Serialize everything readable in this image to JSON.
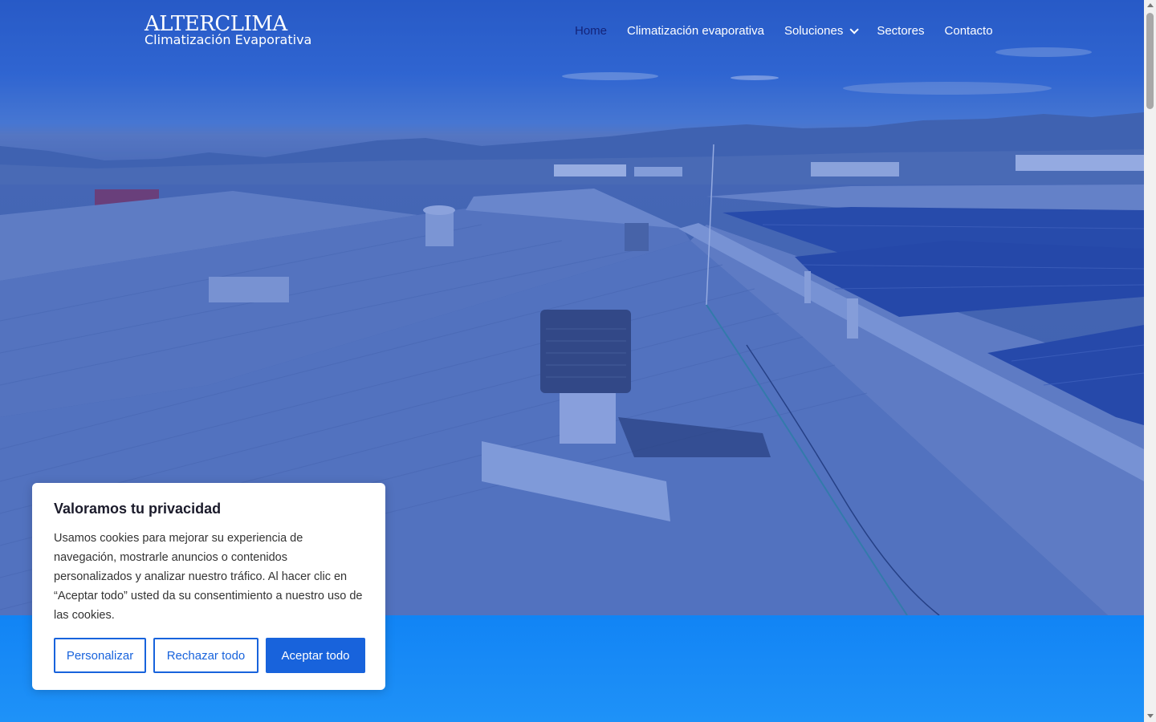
{
  "header": {
    "logo_brand": "ALTERCLIMA",
    "logo_sub": "Climatización Evaporativa",
    "nav": [
      {
        "label": "Home",
        "active": true
      },
      {
        "label": "Climatización evaporativa"
      },
      {
        "label": "Soluciones",
        "has_dropdown": true
      },
      {
        "label": "Sectores"
      },
      {
        "label": "Contacto"
      }
    ]
  },
  "cookie": {
    "title": "Valoramos tu privacidad",
    "body": "Usamos cookies para mejorar su experiencia de navegación, mostrarle anuncios o contenidos personalizados y analizar nuestro tráfico. Al hacer clic en “Aceptar todo” usted da su consentimiento a nuestro uso de las cookies.",
    "customize_label": "Personalizar",
    "reject_label": "Rechazar todo",
    "accept_label": "Aceptar todo"
  },
  "colors": {
    "accent": "#1863dc",
    "nav_active": "#14247a",
    "band": "#1184f5"
  }
}
